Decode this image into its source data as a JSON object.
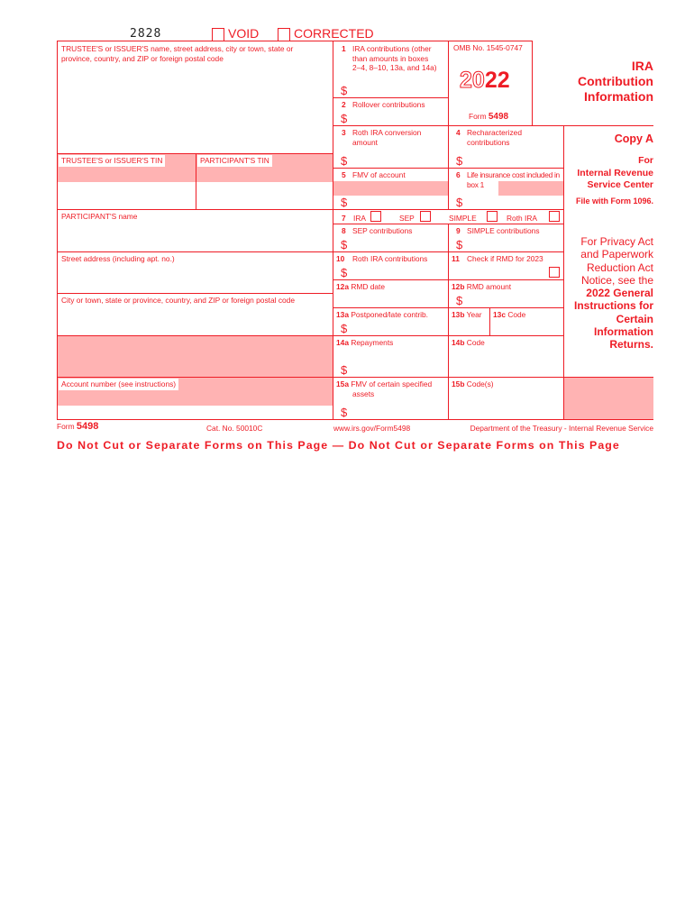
{
  "header": {
    "form_code": "2828",
    "void_label": "VOID",
    "corrected_label": "CORRECTED"
  },
  "left": {
    "trustee_name_label_1": "TRUSTEE'S or ISSUER'S name, street address, city or town, state or",
    "trustee_name_label_2": "province, country, and ZIP or foreign postal code",
    "trustee_tin_label": "TRUSTEE'S or ISSUER'S TIN",
    "participant_tin_label": "PARTICIPANT'S TIN",
    "participant_name_label": "PARTICIPANT'S name",
    "street_label": "Street address (including apt. no.)",
    "city_label": "City or town, state or province, country, and ZIP or foreign postal code",
    "account_label": "Account number (see instructions)"
  },
  "boxes": {
    "b1_num": "1",
    "b1_l1": "IRA contributions (other",
    "b1_l2": "than amounts in boxes",
    "b1_l3": "2–4, 8–10, 13a, and 14a)",
    "b2_num": "2",
    "b2_label": "Rollover contributions",
    "b3_num": "3",
    "b3_l1": "Roth IRA conversion",
    "b3_l2": "amount",
    "b4_num": "4",
    "b4_l1": "Recharacterized",
    "b4_l2": "contributions",
    "b5_num": "5",
    "b5_label": "FMV of account",
    "b6_num": "6",
    "b6_l1": "Life insurance cost included in",
    "b6_l2": "box 1",
    "b7_num": "7",
    "b7_ira": "IRA",
    "b7_sep": "SEP",
    "b7_simple": "SIMPLE",
    "b7_roth": "Roth IRA",
    "b8_num": "8",
    "b8_label": "SEP contributions",
    "b9_num": "9",
    "b9_label": "SIMPLE contributions",
    "b10_num": "10",
    "b10_label": "Roth IRA contributions",
    "b11_num": "11",
    "b11_label": "Check if RMD for 2023",
    "b12a_num": "12a",
    "b12a_label": "RMD date",
    "b12b_num": "12b",
    "b12b_label": "RMD amount",
    "b13a_num": "13a",
    "b13a_label": "Postponed/late contrib.",
    "b13b_num": "13b",
    "b13b_label": "Year",
    "b13c_num": "13c",
    "b13c_label": "Code",
    "b14a_num": "14a",
    "b14a_label": "Repayments",
    "b14b_num": "14b",
    "b14b_label": "Code",
    "b15a_num": "15a",
    "b15a_l1": "FMV of certain specified",
    "b15a_l2": "assets",
    "b15b_num": "15b",
    "b15b_label": "Code(s)",
    "dollar": "$"
  },
  "omb": {
    "omb_label": "OMB No. 1545-0747",
    "year_outline": "20",
    "year_bold": "22",
    "form_prefix": "Form",
    "form_number": "5498"
  },
  "side": {
    "title_1": "IRA",
    "title_2": "Contribution",
    "title_3": "Information",
    "copy": "Copy A",
    "for": "For",
    "irs_1": "Internal Revenue",
    "irs_2": "Service Center",
    "file_with": "File with Form 1096.",
    "privacy_1": "For Privacy Act",
    "privacy_2": "and Paperwork",
    "privacy_3": "Reduction Act",
    "privacy_4": "Notice, see the",
    "privacy_5": "2022 General",
    "privacy_6": "Instructions for",
    "privacy_7": "Certain",
    "privacy_8": "Information",
    "privacy_9": "Returns."
  },
  "footer": {
    "form_prefix": "Form",
    "form_number": "5498",
    "cat_no": "Cat. No. 50010C",
    "url": "www.irs.gov/Form5498",
    "dept": "Department of the Treasury - Internal Revenue Service",
    "warning": "Do Not Cut or Separate Forms on This Page — Do Not Cut or Separate Forms on This Page"
  }
}
